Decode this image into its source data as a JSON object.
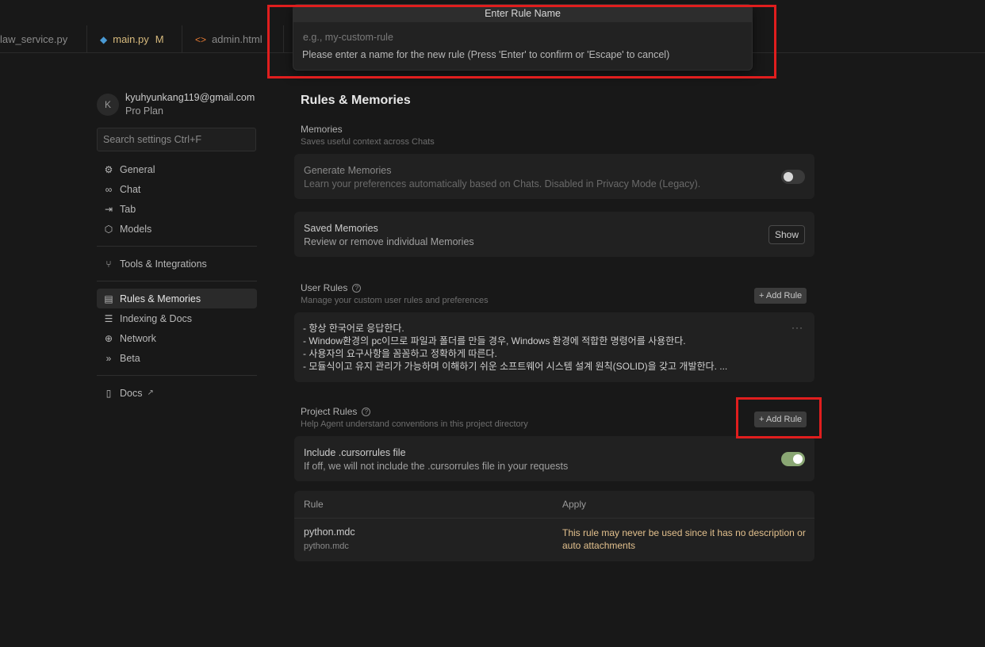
{
  "tabs": [
    {
      "label": "law_service.py",
      "icon": "none"
    },
    {
      "label": "main.py",
      "icon": "python-icon",
      "modified": "M"
    },
    {
      "label": "admin.html",
      "icon": "code-icon"
    }
  ],
  "palette": {
    "title": "Enter Rule Name",
    "placeholder": "e.g., my-custom-rule",
    "message": "Please enter a name for the new rule (Press 'Enter' to confirm or 'Escape' to cancel)"
  },
  "sidebar": {
    "avatar_letter": "K",
    "email": "kyuhyunkang119@gmail.com",
    "plan": "Pro Plan",
    "search_placeholder": "Search settings Ctrl+F",
    "items": [
      {
        "label": "General",
        "icon": "gear-icon"
      },
      {
        "label": "Chat",
        "icon": "infinity-icon"
      },
      {
        "label": "Tab",
        "icon": "tab-arrow-icon"
      },
      {
        "label": "Models",
        "icon": "cube-icon"
      },
      {
        "label": "Tools & Integrations",
        "icon": "nodes-icon"
      },
      {
        "label": "Rules & Memories",
        "icon": "clipboard-icon",
        "active": true
      },
      {
        "label": "Indexing & Docs",
        "icon": "database-icon"
      },
      {
        "label": "Network",
        "icon": "globe-icon"
      },
      {
        "label": "Beta",
        "icon": "chevrons-right-icon"
      },
      {
        "label": "Docs",
        "icon": "book-icon",
        "external": true
      }
    ]
  },
  "main": {
    "title": "Rules & Memories",
    "memories": {
      "label": "Memories",
      "desc": "Saves useful context across Chats",
      "generate": {
        "title": "Generate Memories",
        "desc": "Learn your preferences automatically based on Chats. Disabled in Privacy Mode (Legacy).",
        "enabled": false
      },
      "saved": {
        "title": "Saved Memories",
        "desc": "Review or remove individual Memories",
        "button": "Show"
      }
    },
    "user_rules": {
      "label": "User Rules",
      "desc": "Manage your custom user rules and preferences",
      "add_button": "+ Add Rule",
      "lines": [
        "- 항상 한국어로 응답한다.",
        "- Window환경의 pc이므로 파일과 폴더를 만들 경우, Windows 환경에 적합한 명령어를 사용한다.",
        "- 사용자의 요구사항을 꼼꼼하고 정확하게 따른다.",
        "- 모듈식이고 유지 관리가 가능하며 이해하기 쉬운 소프트웨어 시스템 설계 원칙(SOLID)을 갖고 개발한다. ..."
      ],
      "more": "···"
    },
    "project_rules": {
      "label": "Project Rules",
      "desc": "Help Agent understand conventions in this project directory",
      "add_button": "+ Add Rule",
      "cursorrules": {
        "title": "Include .cursorrules file",
        "desc": "If off, we will not include the .cursorrules file in your requests",
        "enabled": true
      },
      "table": {
        "headers": [
          "Rule",
          "Apply"
        ],
        "rows": [
          {
            "name": "python.mdc",
            "file": "python.mdc",
            "apply": "This rule may never be used since it has no description or auto attachments"
          }
        ]
      }
    }
  },
  "colors": {
    "background": "#181818",
    "card": "#212121",
    "accent_toggle": "#8aa774",
    "warning_text": "#e2c08d",
    "highlight_box": "#e01e1e"
  }
}
